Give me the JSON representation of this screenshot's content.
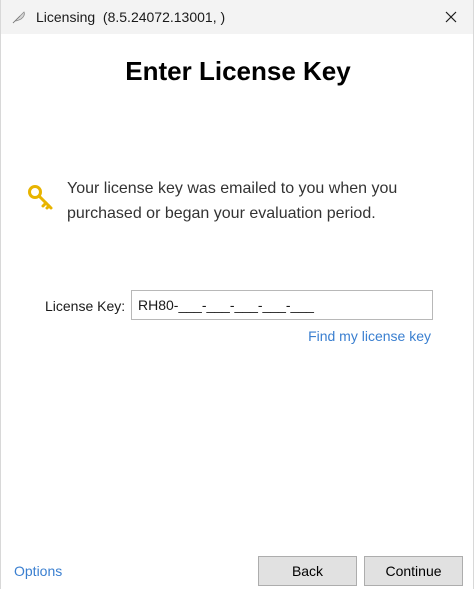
{
  "window": {
    "title": "Licensing  (8.5.24072.13001, )"
  },
  "page": {
    "heading": "Enter License Key",
    "info_text": "Your license key was emailed to you when you purchased or began your evaluation period."
  },
  "license_field": {
    "label": "License Key:",
    "value": "RH80-___-___-___-___-___"
  },
  "links": {
    "find_key": "Find my license key",
    "options": "Options"
  },
  "buttons": {
    "back": "Back",
    "continue": "Continue"
  },
  "icons": {
    "app": "feather-icon",
    "close": "close-icon",
    "key": "key-icon"
  },
  "colors": {
    "link": "#3a7fd0",
    "key_gold": "#e8b400",
    "button_bg": "#e1e1e1"
  }
}
